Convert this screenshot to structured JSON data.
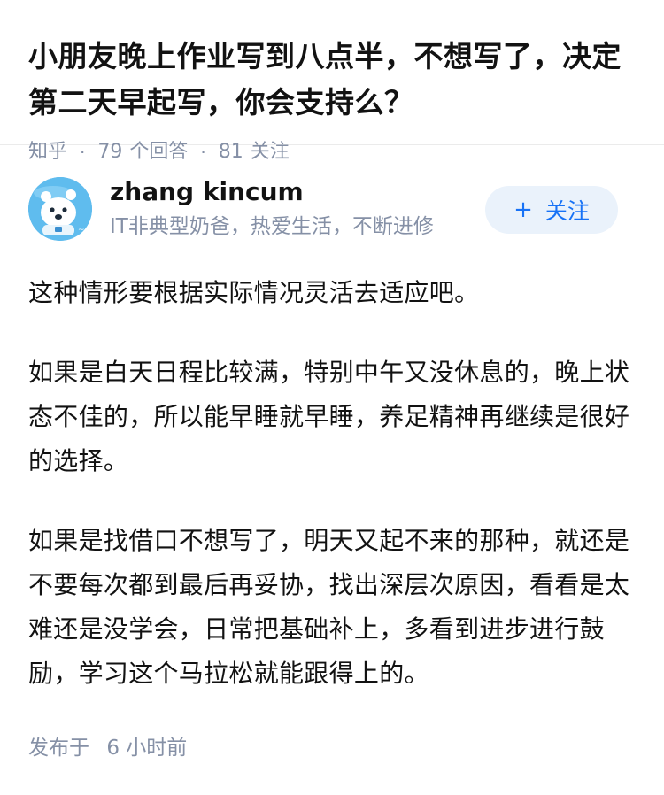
{
  "question": {
    "title": "小朋友晚上作业写到八点半，不想写了，决定第二天早起写，你会支持么？",
    "source": "知乎",
    "answers_count": "79",
    "answers_label": "个回答",
    "followers_count": "81",
    "followers_label": "关注"
  },
  "author": {
    "name": "zhang kincum",
    "bio": "IT非典型奶爸，热爱生活，不断进修",
    "avatar_icon": "cartoon-bear-avatar-icon",
    "follow_label": "关注",
    "follow_icon": "plus-icon",
    "accent_color": "#1772f6"
  },
  "content": {
    "paragraphs": [
      "这种情形要根据实际情况灵活去适应吧。",
      "如果是白天日程比较满，特别中午又没休息的，晚上状态不佳的，所以能早睡就早睡，养足精神再继续是很好的选择。",
      "如果是找借口不想写了，明天又起不来的那种，就还是不要每次都到最后再妥协，找出深层次原因，看看是太难还是没学会，日常把基础补上，多看到进步进行鼓励，学习这个马拉松就能跟得上的。"
    ]
  },
  "footer": {
    "published_prefix": "发布于",
    "published_time": "6 小时前"
  }
}
